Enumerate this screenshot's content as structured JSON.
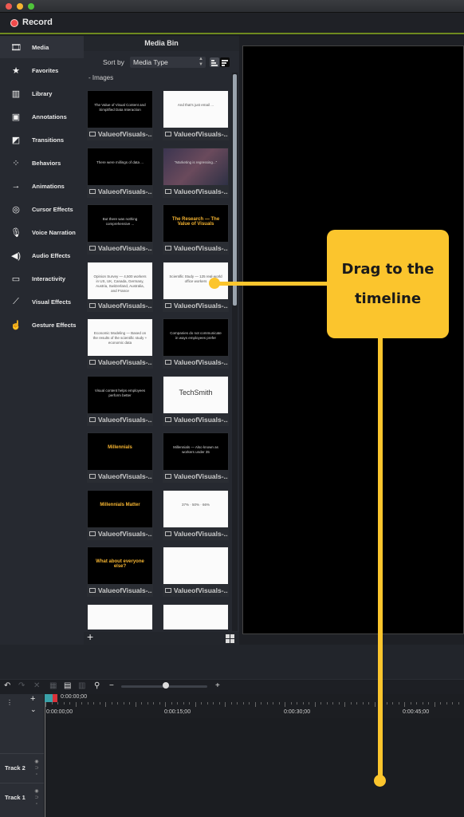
{
  "window": {
    "record_label": "Record"
  },
  "sidebar": {
    "items": [
      {
        "label": "Media",
        "icon": "film-icon",
        "glyph": "🎞",
        "active": true
      },
      {
        "label": "Favorites",
        "icon": "star-icon",
        "glyph": "★"
      },
      {
        "label": "Library",
        "icon": "library-icon",
        "glyph": "▥"
      },
      {
        "label": "Annotations",
        "icon": "annotation-icon",
        "glyph": "▣"
      },
      {
        "label": "Transitions",
        "icon": "transition-icon",
        "glyph": "◩"
      },
      {
        "label": "Behaviors",
        "icon": "behaviors-icon",
        "glyph": "⁘"
      },
      {
        "label": "Animations",
        "icon": "animation-icon",
        "glyph": "→"
      },
      {
        "label": "Cursor Effects",
        "icon": "cursor-effects-icon",
        "glyph": "◎"
      },
      {
        "label": "Voice Narration",
        "icon": "microphone-icon",
        "glyph": "🎙"
      },
      {
        "label": "Audio Effects",
        "icon": "speaker-icon",
        "glyph": "◀)"
      },
      {
        "label": "Interactivity",
        "icon": "interactivity-icon",
        "glyph": "▭"
      },
      {
        "label": "Visual Effects",
        "icon": "magic-wand-icon",
        "glyph": "⟋"
      },
      {
        "label": "Gesture Effects",
        "icon": "hand-gesture-icon",
        "glyph": "☝"
      }
    ]
  },
  "media_bin": {
    "title": "Media Bin",
    "sort_label": "Sort by",
    "sort_value": "Media Type",
    "section_label": "Images",
    "tiles": [
      {
        "caption": "ValueofVisuals-...",
        "text": "The Value of Visual Content and Simplified Data Interaction",
        "style": "dark"
      },
      {
        "caption": "ValueofVisuals-...",
        "text": "And that's just email ...",
        "style": "white"
      },
      {
        "caption": "ValueofVisuals-...",
        "text": "There were millings of data ...",
        "style": "dark"
      },
      {
        "caption": "ValueofVisuals-...",
        "text": "\"Marketing is regressing...\"",
        "style": "photo"
      },
      {
        "caption": "ValueofVisuals-...",
        "text": "But there was nothing comprehensive ...",
        "style": "dark"
      },
      {
        "caption": "ValueofVisuals-...",
        "text": "The Research — The Value of Visuals",
        "style": "dark-title"
      },
      {
        "caption": "ValueofVisuals-...",
        "text": "Opinion Survey — 4,500 workers in US, UK, Canada, Germany, Austria, Switzerland, Australia, and France",
        "style": "white"
      },
      {
        "caption": "ValueofVisuals-...",
        "text": "Scientific Study — 125 real-world office workers",
        "style": "white"
      },
      {
        "caption": "ValueofVisuals-...",
        "text": "Economic Modeling — Based on the results of the scientific study + economic data",
        "style": "white"
      },
      {
        "caption": "ValueofVisuals-...",
        "text": "Companies do not communicate in ways employees prefer",
        "style": "dark"
      },
      {
        "caption": "ValueofVisuals-...",
        "text": "Visual content helps employees perform better",
        "style": "dark"
      },
      {
        "caption": "ValueofVisuals-...",
        "text": "TechSmith",
        "style": "logo"
      },
      {
        "caption": "ValueofVisuals-...",
        "text": "Millennials",
        "style": "dark-title"
      },
      {
        "caption": "ValueofVisuals-...",
        "text": "Millennials — Also known as workers under 35",
        "style": "dark"
      },
      {
        "caption": "ValueofVisuals-...",
        "text": "Millennials Matter",
        "style": "dark-title"
      },
      {
        "caption": "ValueofVisuals-...",
        "text": "37% · 50% · 66%",
        "style": "white"
      },
      {
        "caption": "ValueofVisuals-...",
        "text": "What about everyone else?",
        "style": "dark-title"
      },
      {
        "caption": "ValueofVisuals-...",
        "text": "",
        "style": "white"
      },
      {
        "caption": "",
        "text": "",
        "style": "white"
      },
      {
        "caption": "",
        "text": "",
        "style": "white"
      }
    ]
  },
  "timeline": {
    "playhead_time": "0:00:00;00",
    "ruler_labels": [
      "0:00:00;00",
      "0:00:15;00",
      "0:00:30;00",
      "0:00:45;00"
    ],
    "zoom_level": 0.52,
    "tracks": [
      {
        "label": "Track 2"
      },
      {
        "label": "Track 1"
      }
    ]
  },
  "callout": {
    "text": "Drag to the timeline",
    "color": "#fbc52d"
  }
}
